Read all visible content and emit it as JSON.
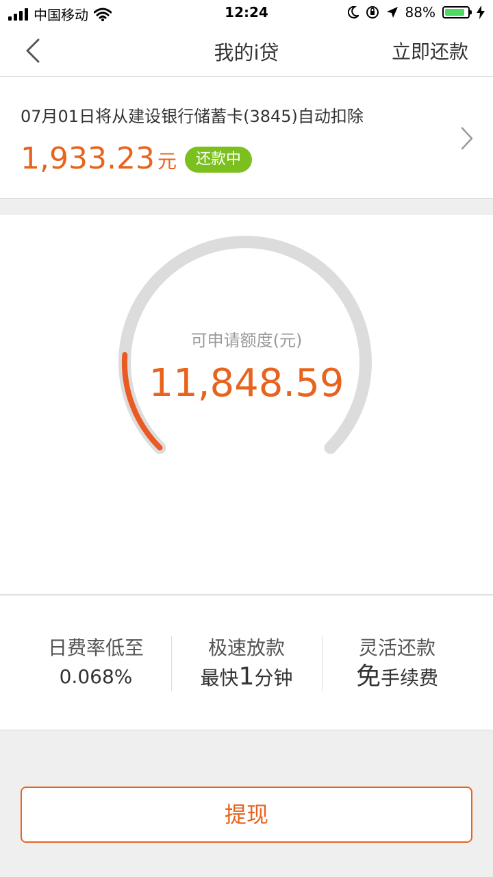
{
  "status_bar": {
    "carrier": "中国移动",
    "time": "12:24",
    "battery_percent": "88%",
    "battery_level": 0.88,
    "icons": [
      "signal-icon",
      "wifi-icon",
      "moon-icon",
      "orientation-lock-icon",
      "location-arrow-icon",
      "battery-icon",
      "charging-bolt-icon"
    ]
  },
  "nav": {
    "title": "我的i贷",
    "action": "立即还款",
    "back_icon": "back-chevron-icon"
  },
  "repayment": {
    "description": "07月01日将从建设银行储蓄卡(3845)自动扣除",
    "amount": "1,933.23",
    "unit": "元",
    "status": "还款中",
    "colors": {
      "amount": "#e8631d",
      "badge": "#7cc01f"
    }
  },
  "credit": {
    "label": "可申请额度(元)",
    "value": "11,848.59",
    "progress_fraction": 0.18,
    "colors": {
      "track": "#dcdcdc",
      "progress": "#ec5a24",
      "value": "#e8631d"
    }
  },
  "features": [
    {
      "title": "日费率低至",
      "sub": "0.068%"
    },
    {
      "title": "极速放款",
      "sub_pre": "最快",
      "sub_big": "1",
      "sub_post": "分钟"
    },
    {
      "title": "灵活还款",
      "sub_big": "免",
      "sub_post": "手续费"
    }
  ],
  "withdraw_button": {
    "label": "提现",
    "color": "#e8631d"
  }
}
